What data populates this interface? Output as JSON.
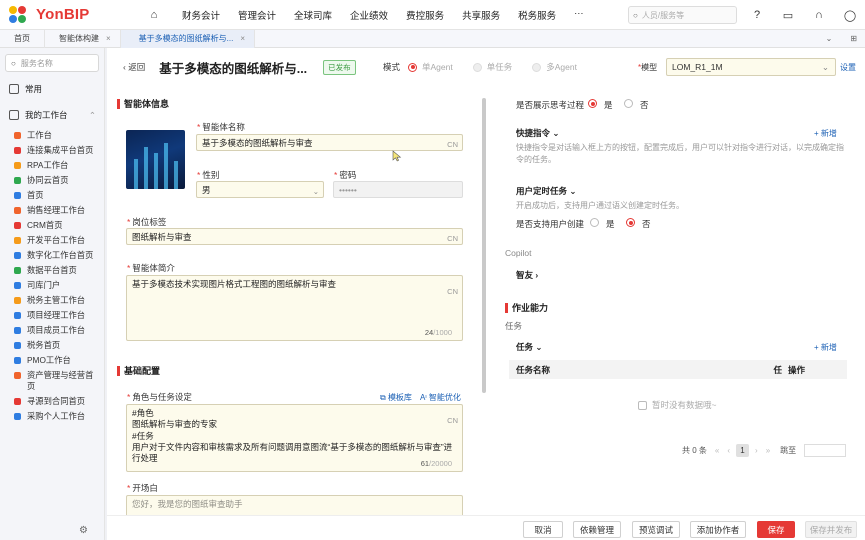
{
  "topbar": {
    "brand": "YonBIP",
    "menu": [
      "财务会计",
      "管理会计",
      "全球司库",
      "企业绩效",
      "费控服务",
      "共享服务",
      "税务服务",
      "···"
    ],
    "search_placeholder": "人员/服务等",
    "icons": [
      "help-icon",
      "message-icon",
      "headset-icon",
      "user-icon"
    ]
  },
  "tabs": [
    {
      "label": "首页",
      "closable": false,
      "active": false
    },
    {
      "label": "智能体构建",
      "closable": true,
      "active": false
    },
    {
      "label": "基于多模态的图纸解析与...",
      "closable": true,
      "active": true
    }
  ],
  "tab_controls": [
    "⌄",
    "⊞"
  ],
  "sidebar": {
    "search_placeholder": "服务名称",
    "groups": [
      {
        "label": "常用"
      },
      {
        "label": "我的工作台"
      }
    ],
    "items": [
      {
        "label": "工作台",
        "color": "#f0642d"
      },
      {
        "label": "连接集成平台首页",
        "color": "#e53935"
      },
      {
        "label": "RPA工作台",
        "color": "#f59b1b"
      },
      {
        "label": "协同云首页",
        "color": "#2fa84f"
      },
      {
        "label": "首页",
        "color": "#2f7de1"
      },
      {
        "label": "销售经理工作台",
        "color": "#f0642d"
      },
      {
        "label": "CRM首页",
        "color": "#e53935"
      },
      {
        "label": "开发平台工作台",
        "color": "#f59b1b"
      },
      {
        "label": "数字化工作台首页",
        "color": "#2f7de1"
      },
      {
        "label": "数据平台首页",
        "color": "#2fa84f"
      },
      {
        "label": "司库门户",
        "color": "#2f7de1"
      },
      {
        "label": "税务主管工作台",
        "color": "#f59b1b"
      },
      {
        "label": "项目经理工作台",
        "color": "#2f7de1"
      },
      {
        "label": "项目成员工作台",
        "color": "#2f7de1"
      },
      {
        "label": "税务首页",
        "color": "#2f7de1"
      },
      {
        "label": "PMO工作台",
        "color": "#2f7de1"
      },
      {
        "label": "资产管理与经营首页",
        "color": "#f0642d"
      },
      {
        "label": "寻源到合同首页",
        "color": "#e53935"
      },
      {
        "label": "采购个人工作台",
        "color": "#2f7de1"
      }
    ]
  },
  "page": {
    "back": "返回",
    "title": "基于多模态的图纸解析与...",
    "status": "已发布",
    "mode_label": "模式",
    "modes": [
      "单Agent",
      "单任务",
      "多Agent"
    ],
    "model_label": "模型",
    "model_value": "LOM_R1_1M",
    "settings": "设置"
  },
  "agent_info": {
    "section": "智能体信息",
    "name_label": "智能体名称",
    "name_value": "基于多模态的图纸解析与审查",
    "gender_label": "性别",
    "gender_value": "男",
    "password_label": "密码",
    "password_value": "••••••",
    "role_label": "岗位标签",
    "role_value": "图纸解析与审查",
    "intro_label": "智能体简介",
    "intro_value": "基于多模态技术实现图片格式工程图的图纸解析与审查",
    "intro_count": "24",
    "intro_max": "/1000",
    "cn": "CN"
  },
  "basic_config": {
    "section": "基础配置",
    "role_task_label": "角色与任务设定",
    "template_link": "模板库",
    "optimize_link": "智能优化",
    "role_text_lines": [
      "#角色",
      "图纸解析与审查的专家",
      "#任务",
      "用户对于文件内容和审核需求及所有问题调用意图流“基于多模态的图纸解析与审查”进行处理"
    ],
    "role_count": "61",
    "role_max": "/20000",
    "opening_label": "开场白",
    "opening_preview": "您好，我是您的图纸审查助手"
  },
  "right": {
    "show_thinking_label": "是否展示思考过程",
    "yes": "是",
    "no": "否",
    "quick_cmd_title": "快捷指令",
    "add": "新增",
    "quick_cmd_desc": "快捷指令是对话输入框上方的按钮，配置完成后，用户可以针对指令进行对话，以完成确定指令的任务。",
    "timed_task_title": "用户定时任务",
    "timed_task_desc": "开启成功后，支持用户通过语义创建定时任务。",
    "user_create_label": "是否支持用户创建",
    "copilot": "Copilot",
    "zhiyou": "智友",
    "work_section": "作业能力",
    "task_sub": "任务",
    "task_title": "任务",
    "table_headers": [
      "任务名称",
      "任",
      "操作"
    ],
    "empty_text": "暂时没有数据哦~",
    "pager_total": "共 0 条",
    "pager_page": "1",
    "pager_jump": "跳至"
  },
  "footer": {
    "buttons": [
      "取消",
      "依赖管理",
      "预览调试",
      "添加协作者",
      "保存",
      "保存并发布"
    ]
  }
}
